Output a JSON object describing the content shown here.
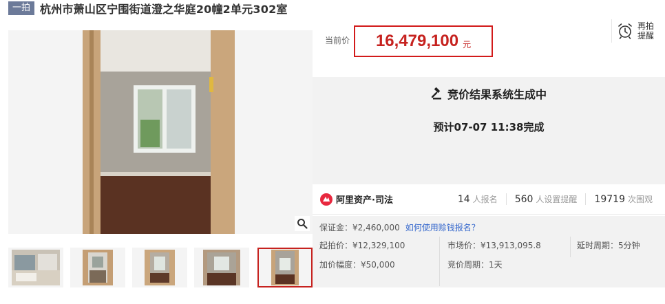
{
  "header": {
    "tag": "一拍",
    "title": "杭州市萧山区宁围街道澄之华庭20幢2单元302室"
  },
  "price": {
    "label": "当前价",
    "value": "16,479,100",
    "unit": "元"
  },
  "remind": {
    "label": "再拍提醒"
  },
  "status": {
    "text": "竞价结果系统生成中",
    "eta": "预计07-07 11:38完成"
  },
  "brand": {
    "name": "阿里资产·司法"
  },
  "stats": [
    {
      "num": "14",
      "unit": "人报名"
    },
    {
      "num": "560",
      "unit": "人设置提醒"
    },
    {
      "num": "19719",
      "unit": "次围观"
    }
  ],
  "info": {
    "deposit": "保证金：¥2,460,000",
    "deposit_link": "如何使用赊钱报名？",
    "start_price": "起拍价：¥12,329,100",
    "market_price": "市场价：¥13,913,095.8",
    "delay_period": "延时周期：5分钟",
    "increment": "加价幅度：¥50,000",
    "bidding_period": "竞价周期：1天"
  },
  "colors": {
    "accent_red": "#c6221f",
    "tag_bg": "#6c7a99",
    "link_blue": "#3366cc",
    "panel_gray": "#f2f2f2"
  }
}
